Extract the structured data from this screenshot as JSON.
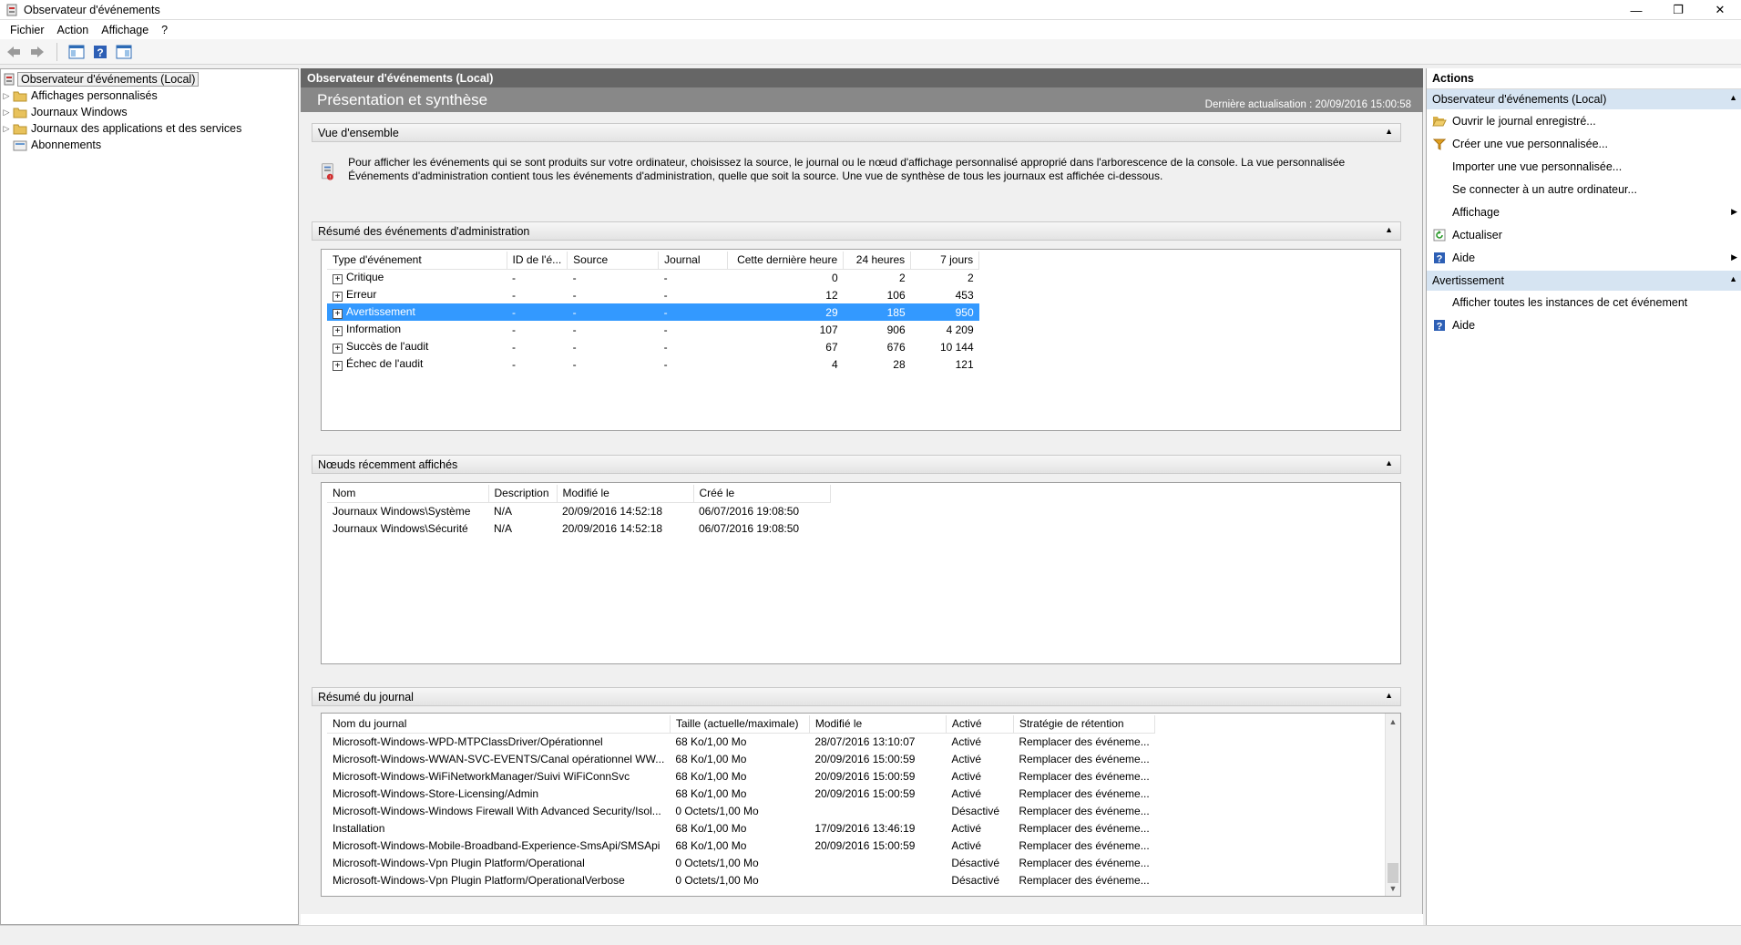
{
  "window": {
    "title": "Observateur d'événements"
  },
  "menu": [
    "Fichier",
    "Action",
    "Affichage",
    "?"
  ],
  "tree": [
    {
      "label": "Observateur d'événements (Local)",
      "selected": true,
      "expander": false
    },
    {
      "label": "Affichages personnalisés",
      "expander": true
    },
    {
      "label": "Journaux Windows",
      "expander": true
    },
    {
      "label": "Journaux des applications et des services",
      "expander": true
    },
    {
      "label": "Abonnements",
      "expander": false
    }
  ],
  "center": {
    "header": "Observateur d'événements (Local)",
    "title": "Présentation et synthèse",
    "last_update": "Dernière actualisation : 20/09/2016 15:00:58",
    "overview": {
      "header": "Vue d'ensemble",
      "text": "Pour afficher les événements qui se sont produits sur votre ordinateur, choisissez la source, le journal ou le nœud d'affichage personnalisé approprié dans l'arborescence de la console. La vue personnalisée Événements d'administration contient tous les événements d'administration, quelle que soit la source. Une vue de synthèse de tous les journaux est affichée ci-dessous."
    },
    "admin_summary": {
      "header": "Résumé des événements d'administration",
      "columns": [
        "Type d'événement",
        "ID de l'é...",
        "Source",
        "Journal",
        "Cette dernière heure",
        "24 heures",
        "7 jours"
      ],
      "rows": [
        [
          "Critique",
          "-",
          "-",
          "-",
          "0",
          "2",
          "2"
        ],
        [
          "Erreur",
          "-",
          "-",
          "-",
          "12",
          "106",
          "453"
        ],
        [
          "Avertissement",
          "-",
          "-",
          "-",
          "29",
          "185",
          "950"
        ],
        [
          "Information",
          "-",
          "-",
          "-",
          "107",
          "906",
          "4 209"
        ],
        [
          "Succès de l'audit",
          "-",
          "-",
          "-",
          "67",
          "676",
          "10 144"
        ],
        [
          "Échec de l'audit",
          "-",
          "-",
          "-",
          "4",
          "28",
          "121"
        ]
      ],
      "selected_row": 2
    },
    "recent_nodes": {
      "header": "Nœuds récemment affichés",
      "columns": [
        "Nom",
        "Description",
        "Modifié le",
        "Créé le"
      ],
      "rows": [
        [
          "Journaux Windows\\Système",
          "N/A",
          "20/09/2016 14:52:18",
          "06/07/2016 19:08:50"
        ],
        [
          "Journaux Windows\\Sécurité",
          "N/A",
          "20/09/2016 14:52:18",
          "06/07/2016 19:08:50"
        ]
      ]
    },
    "log_summary": {
      "header": "Résumé du journal",
      "columns": [
        "Nom du journal",
        "Taille (actuelle/maximale)",
        "Modifié le",
        "Activé",
        "Stratégie de rétention"
      ],
      "rows": [
        [
          "Microsoft-Windows-WPD-MTPClassDriver/Opérationnel",
          "68 Ko/1,00 Mo",
          "28/07/2016 13:10:07",
          "Activé",
          "Remplacer des événeme..."
        ],
        [
          "Microsoft-Windows-WWAN-SVC-EVENTS/Canal opérationnel WW...",
          "68 Ko/1,00 Mo",
          "20/09/2016 15:00:59",
          "Activé",
          "Remplacer des événeme..."
        ],
        [
          "Microsoft-Windows-WiFiNetworkManager/Suivi WiFiConnSvc",
          "68 Ko/1,00 Mo",
          "20/09/2016 15:00:59",
          "Activé",
          "Remplacer des événeme..."
        ],
        [
          "Microsoft-Windows-Store-Licensing/Admin",
          "68 Ko/1,00 Mo",
          "20/09/2016 15:00:59",
          "Activé",
          "Remplacer des événeme..."
        ],
        [
          "Microsoft-Windows-Windows Firewall With Advanced Security/Isol...",
          "0 Octets/1,00 Mo",
          "",
          "Désactivé",
          "Remplacer des événeme..."
        ],
        [
          "Installation",
          "68 Ko/1,00 Mo",
          "17/09/2016 13:46:19",
          "Activé",
          "Remplacer des événeme..."
        ],
        [
          "Microsoft-Windows-Mobile-Broadband-Experience-SmsApi/SMSApi",
          "68 Ko/1,00 Mo",
          "20/09/2016 15:00:59",
          "Activé",
          "Remplacer des événeme..."
        ],
        [
          "Microsoft-Windows-Vpn Plugin Platform/Operational",
          "0 Octets/1,00 Mo",
          "",
          "Désactivé",
          "Remplacer des événeme..."
        ],
        [
          "Microsoft-Windows-Vpn Plugin Platform/OperationalVerbose",
          "0 Octets/1,00 Mo",
          "",
          "Désactivé",
          "Remplacer des événeme..."
        ]
      ]
    }
  },
  "actions": {
    "title": "Actions",
    "group1": "Observateur d'événements (Local)",
    "items1": [
      {
        "label": "Ouvrir le journal enregistré...",
        "icon": "folder-open-icon"
      },
      {
        "label": "Créer une vue personnalisée...",
        "icon": "filter-icon"
      },
      {
        "label": "Importer une vue personnalisée...",
        "icon": ""
      },
      {
        "label": "Se connecter à un autre ordinateur...",
        "icon": ""
      },
      {
        "label": "Affichage",
        "icon": "",
        "submenu": true
      },
      {
        "label": "Actualiser",
        "icon": "refresh-icon"
      },
      {
        "label": "Aide",
        "icon": "help-icon",
        "submenu": true
      }
    ],
    "group2": "Avertissement",
    "items2": [
      {
        "label": "Afficher toutes les instances de cet événement",
        "icon": ""
      },
      {
        "label": "Aide",
        "icon": "help-icon"
      }
    ]
  }
}
